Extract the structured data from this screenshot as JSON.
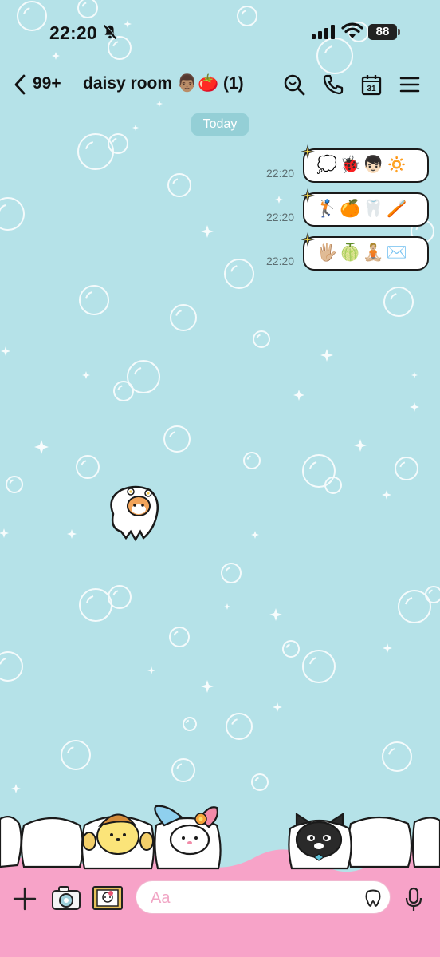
{
  "status_bar": {
    "time": "22:20",
    "battery": "88"
  },
  "header": {
    "back_count": "99+",
    "title": "daisy room 👨🏽🍅 (1)"
  },
  "date_chip": "Today",
  "messages": [
    {
      "time": "22:20",
      "content": "💭🐞👦🏻🔅"
    },
    {
      "time": "22:20",
      "content": "🏌🏻🍊🦷🪥"
    },
    {
      "time": "22:20",
      "content": "🖐🏼🍈🧘🏼✉️"
    }
  ],
  "input": {
    "placeholder": "Aa"
  },
  "colors": {
    "background": "#b5e2e8",
    "input_bar": "#f7a3c8",
    "accent_pink": "#f1a6c5"
  }
}
